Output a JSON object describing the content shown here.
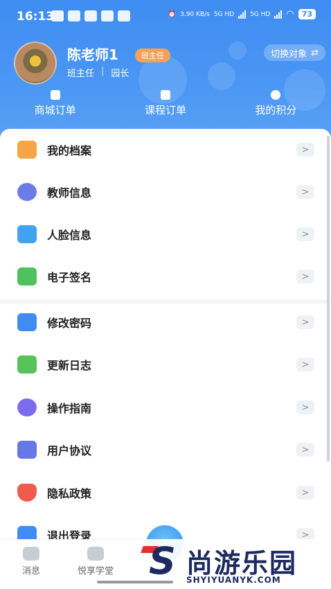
{
  "status_bar": {
    "time": "16:13",
    "net_speed": "3.90\nKB/s",
    "sig1": "5G HD",
    "sig2": "5G HD",
    "battery": "73"
  },
  "profile": {
    "name": "陈老师1",
    "role_badge": "班主任",
    "sub_role_1": "班主任",
    "sub_role_sep": "|",
    "sub_role_2": "园长",
    "switch_label": "切换对象",
    "switch_icon": "⇄"
  },
  "quick_links": [
    {
      "label": "商城订单",
      "icon": "bag-icon"
    },
    {
      "label": "课程订单",
      "icon": "book-icon"
    },
    {
      "label": "我的积分",
      "icon": "coins-icon"
    }
  ],
  "menu_group_1": [
    {
      "label": "我的档案",
      "icon": "archive-icon",
      "color": "#f5a546"
    },
    {
      "label": "教师信息",
      "icon": "teacher-icon",
      "color": "#6b7bea"
    },
    {
      "label": "人脸信息",
      "icon": "face-scan-icon",
      "color": "#3fa3f0"
    },
    {
      "label": "电子签名",
      "icon": "signature-icon",
      "color": "#4fc15e"
    }
  ],
  "menu_group_2": [
    {
      "label": "修改密码",
      "icon": "lock-icon",
      "color": "#3f8df2"
    },
    {
      "label": "更新日志",
      "icon": "refresh-icon",
      "color": "#56c45a"
    },
    {
      "label": "操作指南",
      "icon": "question-icon",
      "color": "#7b6cf0"
    },
    {
      "label": "用户协议",
      "icon": "document-icon",
      "color": "#6678e8"
    },
    {
      "label": "隐私政策",
      "icon": "shield-icon",
      "color": "#ef5b4d"
    },
    {
      "label": "退出登录",
      "icon": "power-icon",
      "color": "#3f8df2"
    }
  ],
  "arrow": ">",
  "tabbar": {
    "tab1": "消息",
    "tab2": "悦享学堂"
  },
  "watermark": {
    "brand": "尚游乐园",
    "url": "SHYIYUANYK.COM",
    "letter": "S"
  }
}
